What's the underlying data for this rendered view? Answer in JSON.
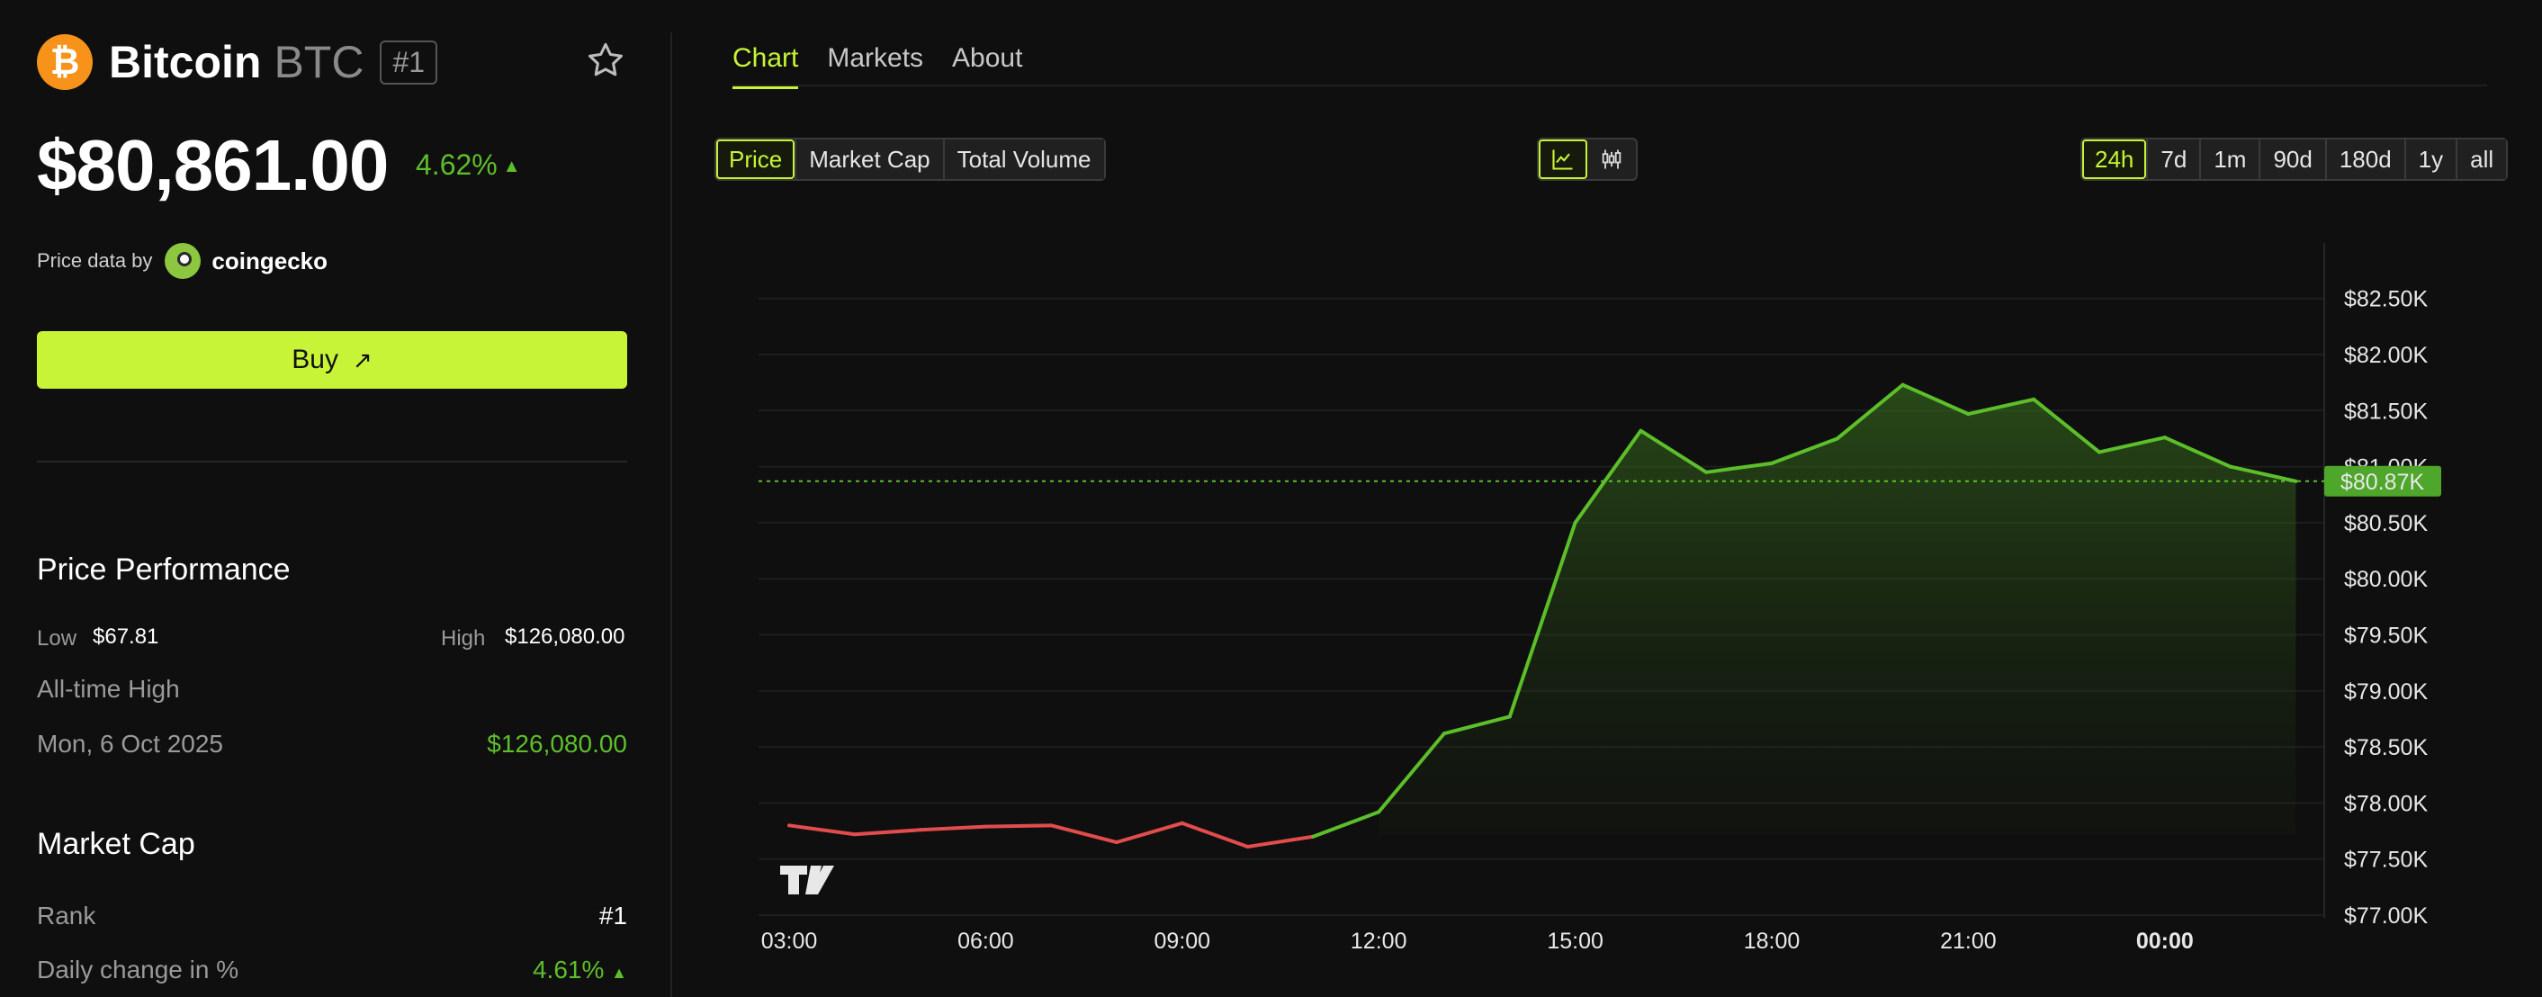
{
  "coin": {
    "name": "Bitcoin",
    "symbol": "BTC",
    "rank_badge": "#1",
    "logo_glyph": "₿",
    "price": "$80,861.00",
    "change": "4.62%",
    "change_arrow": "▲"
  },
  "price_data": {
    "label": "Price data by",
    "provider": "coingecko"
  },
  "buy": {
    "label": "Buy",
    "arrow": "↗"
  },
  "performance": {
    "title": "Price Performance",
    "low_label": "Low",
    "low_value": "$67.81",
    "high_label": "High",
    "high_value": "$126,080.00",
    "ath_label": "All-time High",
    "ath_date": "Mon, 6 Oct 2025",
    "ath_value": "$126,080.00"
  },
  "market_cap": {
    "title": "Market Cap",
    "rank_label": "Rank",
    "rank_value": "#1",
    "daily_label": "Daily change in %",
    "daily_value": "4.61%",
    "daily_arrow": "▲"
  },
  "tabs": [
    {
      "label": "Chart",
      "active": true
    },
    {
      "label": "Markets",
      "active": false
    },
    {
      "label": "About",
      "active": false
    }
  ],
  "metric_options": [
    "Price",
    "Market Cap",
    "Total Volume"
  ],
  "range_options": [
    "24h",
    "7d",
    "1m",
    "90d",
    "180d",
    "1y",
    "all"
  ],
  "colors": {
    "accent": "#c7f436",
    "up": "#5cbf2a",
    "down": "#e34c4c",
    "btc": "#f7931a"
  },
  "icons": {
    "star": "star-icon",
    "line_chart": "line-chart-icon",
    "candle_chart": "candlestick-icon",
    "watermark": "tradingview-logo"
  },
  "chart_data": {
    "type": "area",
    "x_labels": [
      "03:00",
      "06:00",
      "09:00",
      "12:00",
      "15:00",
      "18:00",
      "21:00",
      "00:00"
    ],
    "x_hours": [
      3,
      6,
      9,
      12,
      15,
      18,
      21,
      24
    ],
    "y_ticks": [
      77000,
      77500,
      78000,
      78500,
      79000,
      79500,
      80000,
      80500,
      81000,
      81500,
      82000,
      82500
    ],
    "y_tick_labels": [
      "$77.00K",
      "$77.50K",
      "$78.00K",
      "$78.50K",
      "$79.00K",
      "$79.50K",
      "$80.00K",
      "$80.50K",
      "$81.00K",
      "$81.50K",
      "$82.00K",
      "$82.50K"
    ],
    "ylim": [
      77000,
      82500
    ],
    "current_value": 80870,
    "current_label": "$80.87K",
    "series": [
      {
        "x": [
          3,
          4,
          5,
          6,
          7,
          8,
          9,
          10,
          11,
          12,
          13,
          14,
          15,
          16,
          17,
          18,
          19,
          20,
          21,
          22,
          23,
          24,
          25,
          26
        ],
        "values": [
          77800,
          77720,
          77760,
          77790,
          77800,
          77650,
          77820,
          77610,
          77700,
          77920,
          78620,
          78770,
          80500,
          81320,
          80950,
          81030,
          81250,
          81730,
          81470,
          81600,
          81130,
          81260,
          81000,
          80870
        ]
      }
    ],
    "grid": true,
    "legend": "none"
  }
}
